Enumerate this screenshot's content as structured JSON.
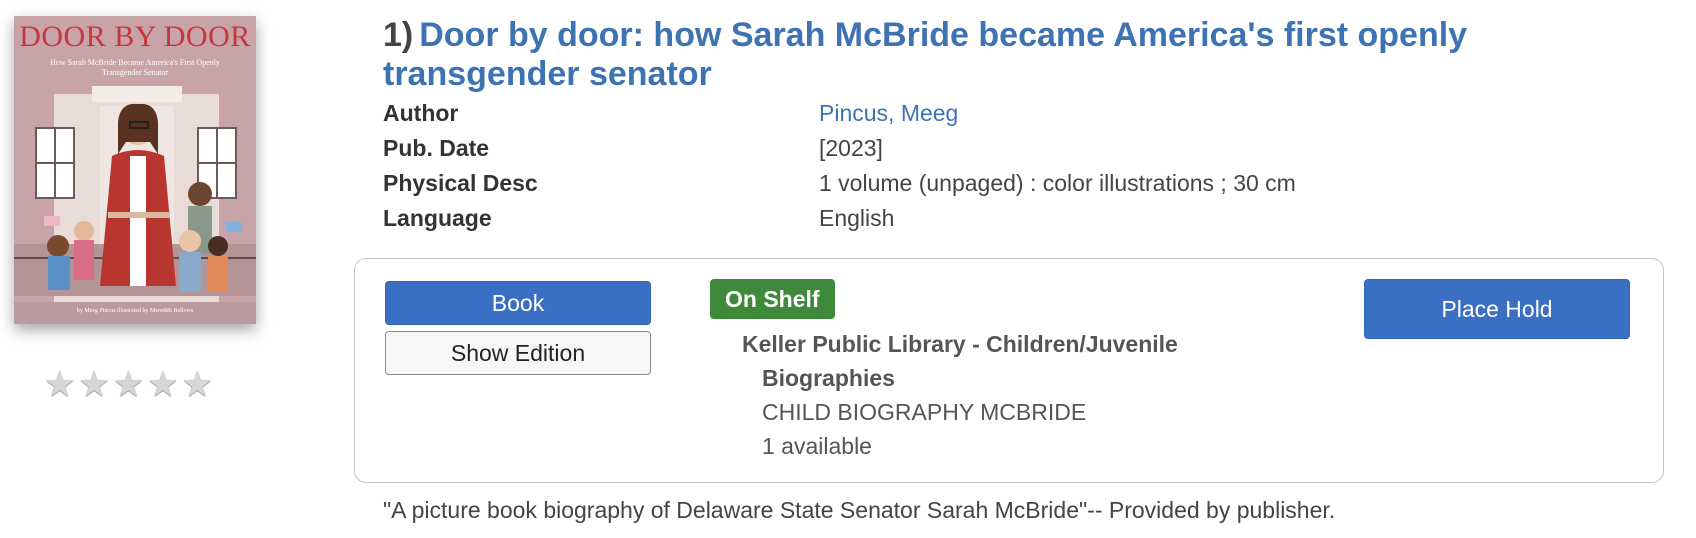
{
  "record": {
    "number": "1)",
    "title": "Door by door: how Sarah McBride became America's first openly transgender senator",
    "cover": {
      "title_text": "DOOR BY DOOR",
      "subtitle_text": "How Sarah McBride Became America's First Openly Transgender Senator",
      "bottom_text": "by Meeg Pincus  illustrated by Meredith Bellows"
    },
    "rating": {
      "stars_filled": 0,
      "stars_total": 5,
      "icon": "star-icon"
    },
    "fields": [
      {
        "label": "Author",
        "value": "Pincus, Meeg",
        "is_link": true
      },
      {
        "label": "Pub. Date",
        "value": "[2023]",
        "is_link": false
      },
      {
        "label": "Physical Desc",
        "value": "1 volume (unpaged) : color illustrations ; 30 cm",
        "is_link": false
      },
      {
        "label": "Language",
        "value": "English",
        "is_link": false
      }
    ],
    "availability": {
      "format_label": "Book",
      "show_edition_label": "Show Edition",
      "status": "On Shelf",
      "location_line1": "Keller Public Library - Children/Juvenile",
      "location_line2": "Biographies",
      "call_number": "CHILD BIOGRAPHY MCBRIDE",
      "available_count": "1 available",
      "place_hold_label": "Place Hold"
    },
    "summary": "\"A picture book biography of Delaware State Senator Sarah McBride\"-- Provided by publisher."
  },
  "colors": {
    "link": "#3d72b3",
    "primary_button": "#3a6fc4",
    "status_green": "#3e8a3a",
    "cover_title": "#c4383c"
  }
}
